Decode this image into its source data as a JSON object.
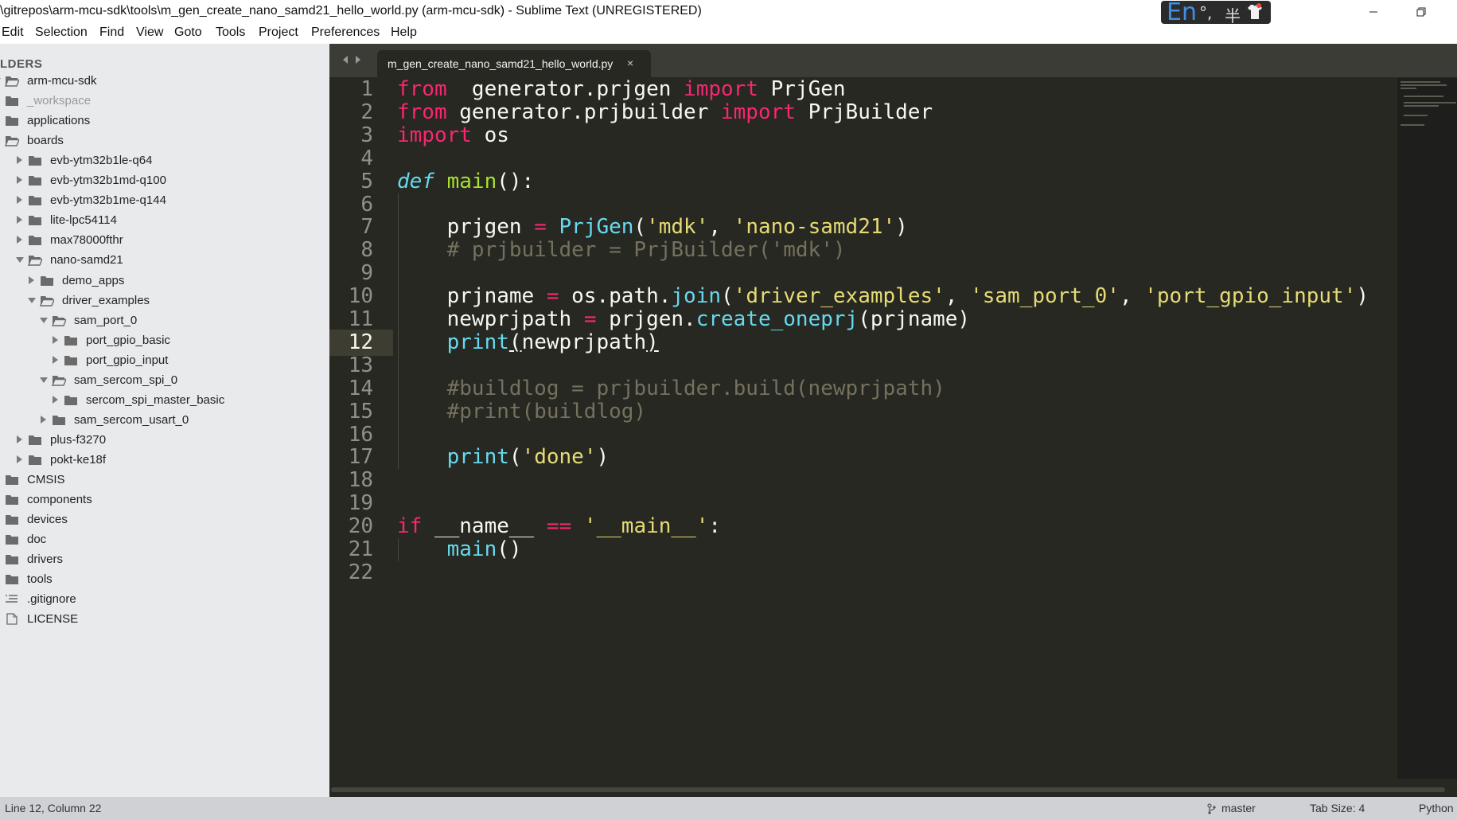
{
  "window": {
    "title": "\\gitrepos\\arm-mcu-sdk\\tools\\m_gen_create_nano_samd21_hello_world.py (arm-mcu-sdk) - Sublime Text (UNREGISTERED)",
    "ime": {
      "lang": "En",
      "punct": "°,",
      "width_mode": "半",
      "icon": "shirt-icon"
    },
    "controls": {
      "minimize": "minimize-icon",
      "restore": "restore-icon"
    }
  },
  "menu": [
    "Edit",
    "Selection",
    "Find",
    "View",
    "Goto",
    "Tools",
    "Project",
    "Preferences",
    "Help"
  ],
  "sidebar": {
    "header": "LDERS",
    "items": [
      {
        "label": "arm-mcu-sdk",
        "icon": "folder-open-icon",
        "arrow": "down",
        "level": 0
      },
      {
        "label": "_workspace",
        "icon": "folder-icon",
        "arrow": "",
        "level": 1,
        "dim": true
      },
      {
        "label": "applications",
        "icon": "folder-icon",
        "arrow": "",
        "level": 1
      },
      {
        "label": "boards",
        "icon": "folder-open-icon",
        "arrow": "",
        "level": 1
      },
      {
        "label": "evb-ytm32b1le-q64",
        "icon": "folder-icon",
        "arrow": "right",
        "level": 2
      },
      {
        "label": "evb-ytm32b1md-q100",
        "icon": "folder-icon",
        "arrow": "right",
        "level": 2
      },
      {
        "label": "evb-ytm32b1me-q144",
        "icon": "folder-icon",
        "arrow": "right",
        "level": 2
      },
      {
        "label": "lite-lpc54114",
        "icon": "folder-icon",
        "arrow": "right",
        "level": 2
      },
      {
        "label": "max78000fthr",
        "icon": "folder-icon",
        "arrow": "right",
        "level": 2
      },
      {
        "label": "nano-samd21",
        "icon": "folder-open-icon",
        "arrow": "down",
        "level": 2
      },
      {
        "label": "demo_apps",
        "icon": "folder-icon",
        "arrow": "right",
        "level": 3
      },
      {
        "label": "driver_examples",
        "icon": "folder-open-icon",
        "arrow": "down",
        "level": 3
      },
      {
        "label": "sam_port_0",
        "icon": "folder-open-icon",
        "arrow": "down",
        "level": 4
      },
      {
        "label": "port_gpio_basic",
        "icon": "folder-icon",
        "arrow": "right",
        "level": 5
      },
      {
        "label": "port_gpio_input",
        "icon": "folder-icon",
        "arrow": "right",
        "level": 5
      },
      {
        "label": "sam_sercom_spi_0",
        "icon": "folder-open-icon",
        "arrow": "down",
        "level": 4
      },
      {
        "label": "sercom_spi_master_basic",
        "icon": "folder-icon",
        "arrow": "right",
        "level": 5
      },
      {
        "label": "sam_sercom_usart_0",
        "icon": "folder-icon",
        "arrow": "right",
        "level": 4
      },
      {
        "label": "plus-f3270",
        "icon": "folder-icon",
        "arrow": "right",
        "level": 2
      },
      {
        "label": "pokt-ke18f",
        "icon": "folder-icon",
        "arrow": "right",
        "level": 2
      },
      {
        "label": "CMSIS",
        "icon": "folder-icon",
        "arrow": "",
        "level": 1
      },
      {
        "label": "components",
        "icon": "folder-icon",
        "arrow": "",
        "level": 1
      },
      {
        "label": "devices",
        "icon": "folder-icon",
        "arrow": "",
        "level": 1
      },
      {
        "label": "doc",
        "icon": "folder-icon",
        "arrow": "",
        "level": 1
      },
      {
        "label": "drivers",
        "icon": "folder-icon",
        "arrow": "",
        "level": 1
      },
      {
        "label": "tools",
        "icon": "folder-icon",
        "arrow": "",
        "level": 1
      },
      {
        "label": ".gitignore",
        "icon": "text-file-icon",
        "arrow": "",
        "level": 1
      },
      {
        "label": "LICENSE",
        "icon": "file-icon",
        "arrow": "",
        "level": 1
      }
    ]
  },
  "editor": {
    "tab": {
      "label": "m_gen_create_nano_samd21_hello_world.py",
      "close": "×"
    },
    "active_line": 12,
    "lines": [
      [
        [
          "kw",
          "from"
        ],
        [
          "",
          "  generator.prjgen "
        ],
        [
          "kw",
          "import"
        ],
        [
          "",
          " PrjGen"
        ]
      ],
      [
        [
          "kw",
          "from"
        ],
        [
          "",
          " generator.prjbuilder "
        ],
        [
          "kw",
          "import"
        ],
        [
          "",
          " PrjBuilder"
        ]
      ],
      [
        [
          "kw",
          "import"
        ],
        [
          "",
          " os"
        ]
      ],
      [],
      [
        [
          "sto",
          "def"
        ],
        [
          "",
          " "
        ],
        [
          "fn",
          "main"
        ],
        [
          "",
          "():"
        ]
      ],
      [],
      [
        [
          "",
          "    prjgen "
        ],
        [
          "kw",
          "="
        ],
        [
          "",
          " "
        ],
        [
          "call",
          "PrjGen"
        ],
        [
          "",
          "("
        ],
        [
          "str",
          "'mdk'"
        ],
        [
          "",
          ", "
        ],
        [
          "str",
          "'nano-samd21'"
        ],
        [
          "",
          ")"
        ]
      ],
      [
        [
          "cm",
          "    # prjbuilder = PrjBuilder('mdk')"
        ]
      ],
      [],
      [
        [
          "",
          "    prjname "
        ],
        [
          "kw",
          "="
        ],
        [
          "",
          " os.path."
        ],
        [
          "call",
          "join"
        ],
        [
          "",
          "("
        ],
        [
          "str",
          "'driver_examples'"
        ],
        [
          "",
          ", "
        ],
        [
          "str",
          "'sam_port_0'"
        ],
        [
          "",
          ", "
        ],
        [
          "str",
          "'port_gpio_input'"
        ],
        [
          "",
          ")"
        ]
      ],
      [
        [
          "",
          "    newprjpath "
        ],
        [
          "kw",
          "="
        ],
        [
          "",
          " prjgen."
        ],
        [
          "call",
          "create_oneprj"
        ],
        [
          "",
          "(prjname)"
        ]
      ],
      [
        [
          "",
          "    "
        ],
        [
          "call",
          "print"
        ],
        [
          "ulb",
          "("
        ],
        [
          "",
          "newprjpath"
        ],
        [
          "ulb",
          ")"
        ]
      ],
      [],
      [
        [
          "cm",
          "    #buildlog = prjbuilder.build(newprjpath)"
        ]
      ],
      [
        [
          "cm",
          "    #print(buildlog)"
        ]
      ],
      [],
      [
        [
          "",
          "    "
        ],
        [
          "call",
          "print"
        ],
        [
          "",
          "("
        ],
        [
          "str",
          "'done'"
        ],
        [
          "",
          ")"
        ]
      ],
      [],
      [],
      [
        [
          "kw",
          "if"
        ],
        [
          "",
          " __name__ "
        ],
        [
          "kw",
          "=="
        ],
        [
          "",
          " "
        ],
        [
          "str",
          "'__main__'"
        ],
        [
          "",
          ":"
        ]
      ],
      [
        [
          "",
          "    "
        ],
        [
          "call",
          "main"
        ],
        [
          "",
          "()"
        ]
      ],
      []
    ]
  },
  "status": {
    "position": "Line 12, Column 22",
    "branch": "master",
    "branch_icon": "git-branch-icon",
    "tab_size": "Tab Size: 4",
    "syntax": "Python"
  }
}
